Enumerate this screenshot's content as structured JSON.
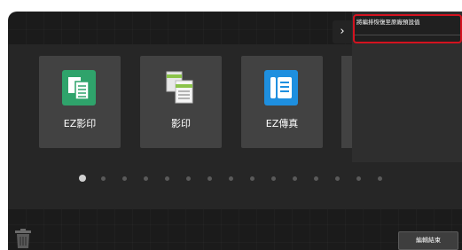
{
  "header": {
    "panel_toggle_glyph": "›",
    "callout_text": "將編排恢復至原廠預設值",
    "callout_border_color": "#d4121f"
  },
  "tiles": [
    {
      "label": "EZ影印",
      "icon": "ez-copy-icon",
      "icon_color": "#2fa36b"
    },
    {
      "label": "影印",
      "icon": "copy-icon",
      "icon_color": "#8bc34a"
    },
    {
      "label": "EZ傳真",
      "icon": "ez-fax-icon",
      "icon_color": "#1e8fdf"
    }
  ],
  "pagination": {
    "total_pages": 15,
    "current_page": 1
  },
  "footer": {
    "trash_icon": "trash-icon",
    "end_edit_label": "編輯結束"
  }
}
